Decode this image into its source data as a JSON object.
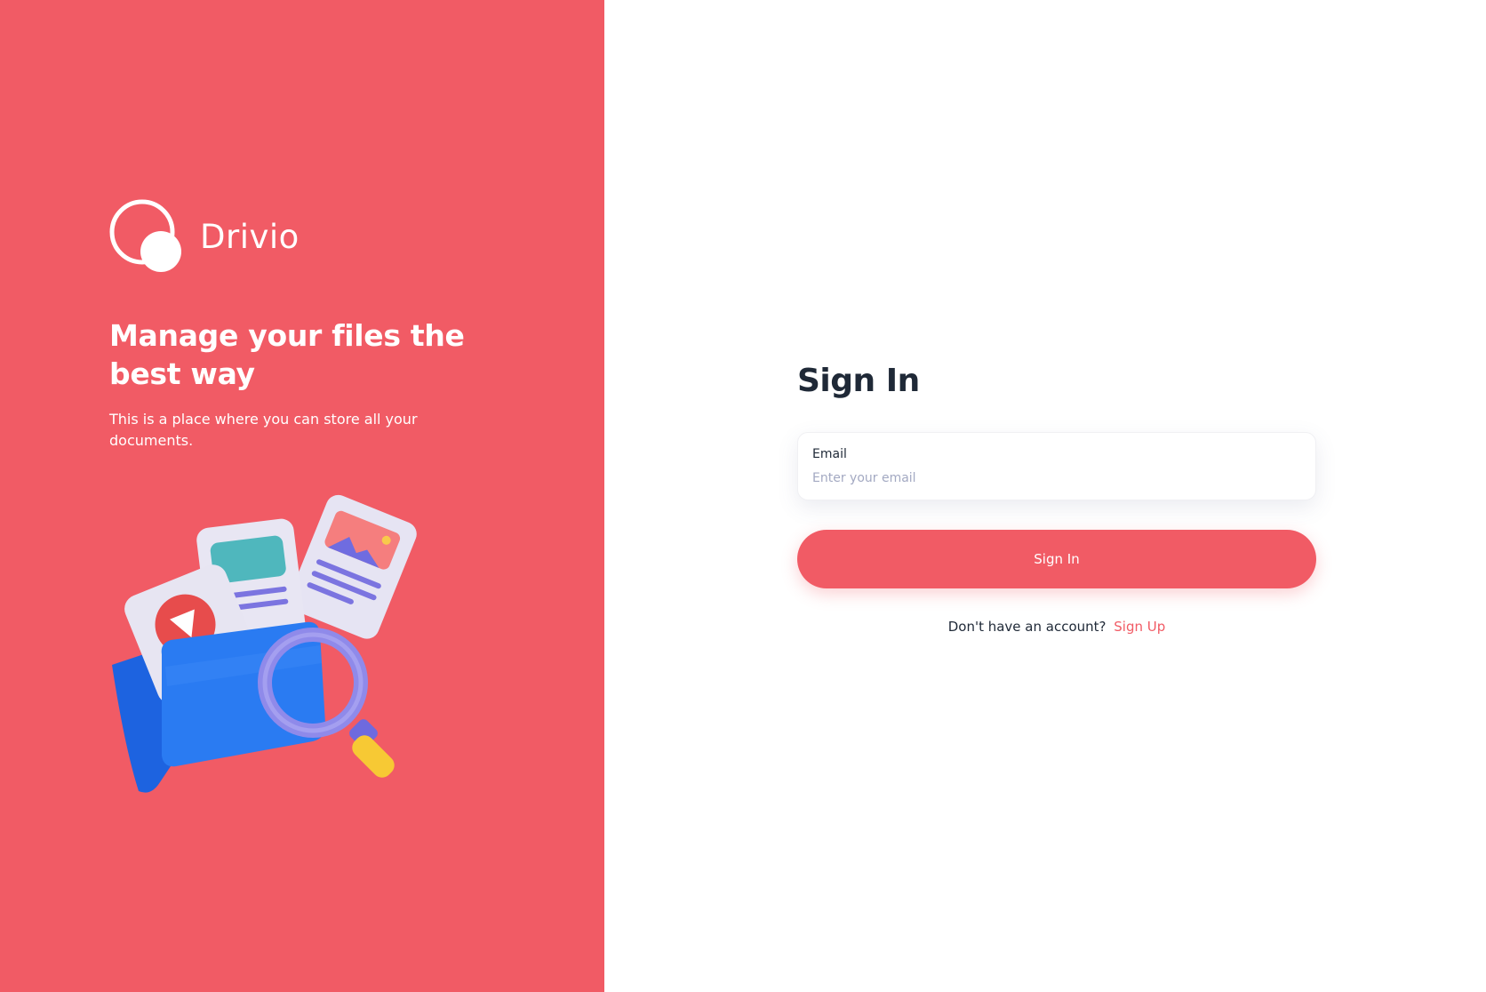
{
  "brand": {
    "name": "Drivio",
    "logo_icon": "drivio-logo-icon"
  },
  "hero": {
    "headline": "Manage your files the best way",
    "subline": "This is a place where you can store all your documents.",
    "illustration_icon": "folder-files-magnifier-illustration"
  },
  "signin": {
    "title": "Sign In",
    "email_label": "Email",
    "email_placeholder": "Enter your email",
    "email_value": "",
    "button_label": "Sign In",
    "no_account_text": "Don't have an account?",
    "signup_link": "Sign Up"
  },
  "colors": {
    "brand": "#F15B65",
    "heading_text": "#1F2937",
    "placeholder": "#A3A9C2",
    "panel_background": "#FFFFFF"
  }
}
